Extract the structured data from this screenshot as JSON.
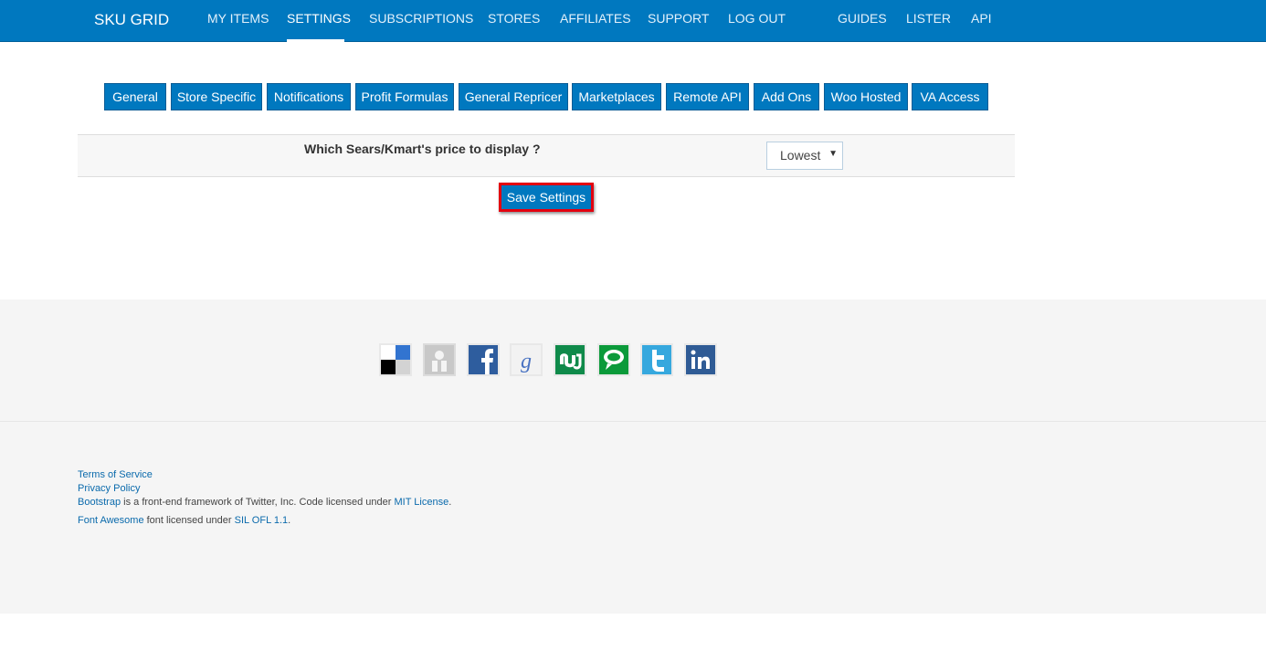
{
  "navbar": {
    "brand": "SKU GRID",
    "items": [
      {
        "label": "MY ITEMS",
        "active": false
      },
      {
        "label": "SETTINGS",
        "active": true
      },
      {
        "label": "SUBSCRIPTIONS",
        "active": false
      },
      {
        "label": "STORES",
        "active": false
      },
      {
        "label": "AFFILIATES",
        "active": false
      },
      {
        "label": "SUPPORT",
        "active": false
      },
      {
        "label": "LOG OUT",
        "active": false
      },
      {
        "label": "GUIDES",
        "active": false
      },
      {
        "label": "LISTER",
        "active": false
      },
      {
        "label": "API",
        "active": false
      }
    ]
  },
  "settings_tabs": [
    "General",
    "Store Specific",
    "Notifications",
    "Profit Formulas",
    "General Repricer",
    "Marketplaces",
    "Remote API",
    "Add Ons",
    "Woo Hosted",
    "VA Access"
  ],
  "setting": {
    "label": "Which Sears/Kmart's price to display ?",
    "select_value": "Lowest",
    "select_arrow": "▼"
  },
  "save_button": "Save Settings",
  "social_icons": [
    "delicious-icon",
    "digg-icon",
    "facebook-icon",
    "google-icon",
    "stumbleupon-icon",
    "technorati-icon",
    "twitter-icon",
    "linkedin-icon"
  ],
  "footer": {
    "terms": "Terms of Service",
    "privacy": "Privacy Policy",
    "bootstrap_link": "Bootstrap",
    "bootstrap_text": " is a front-end framework of Twitter, Inc. Code licensed under ",
    "mit_link": "MIT License",
    "period1": ".",
    "fa_link": "Font Awesome",
    "fa_text": " font licensed under ",
    "sil_link": "SIL OFL 1.1",
    "period2": "."
  },
  "colors": {
    "primary": "#0078bf",
    "highlight_border": "#e3000f",
    "footer_bg": "#f5f5f5"
  }
}
